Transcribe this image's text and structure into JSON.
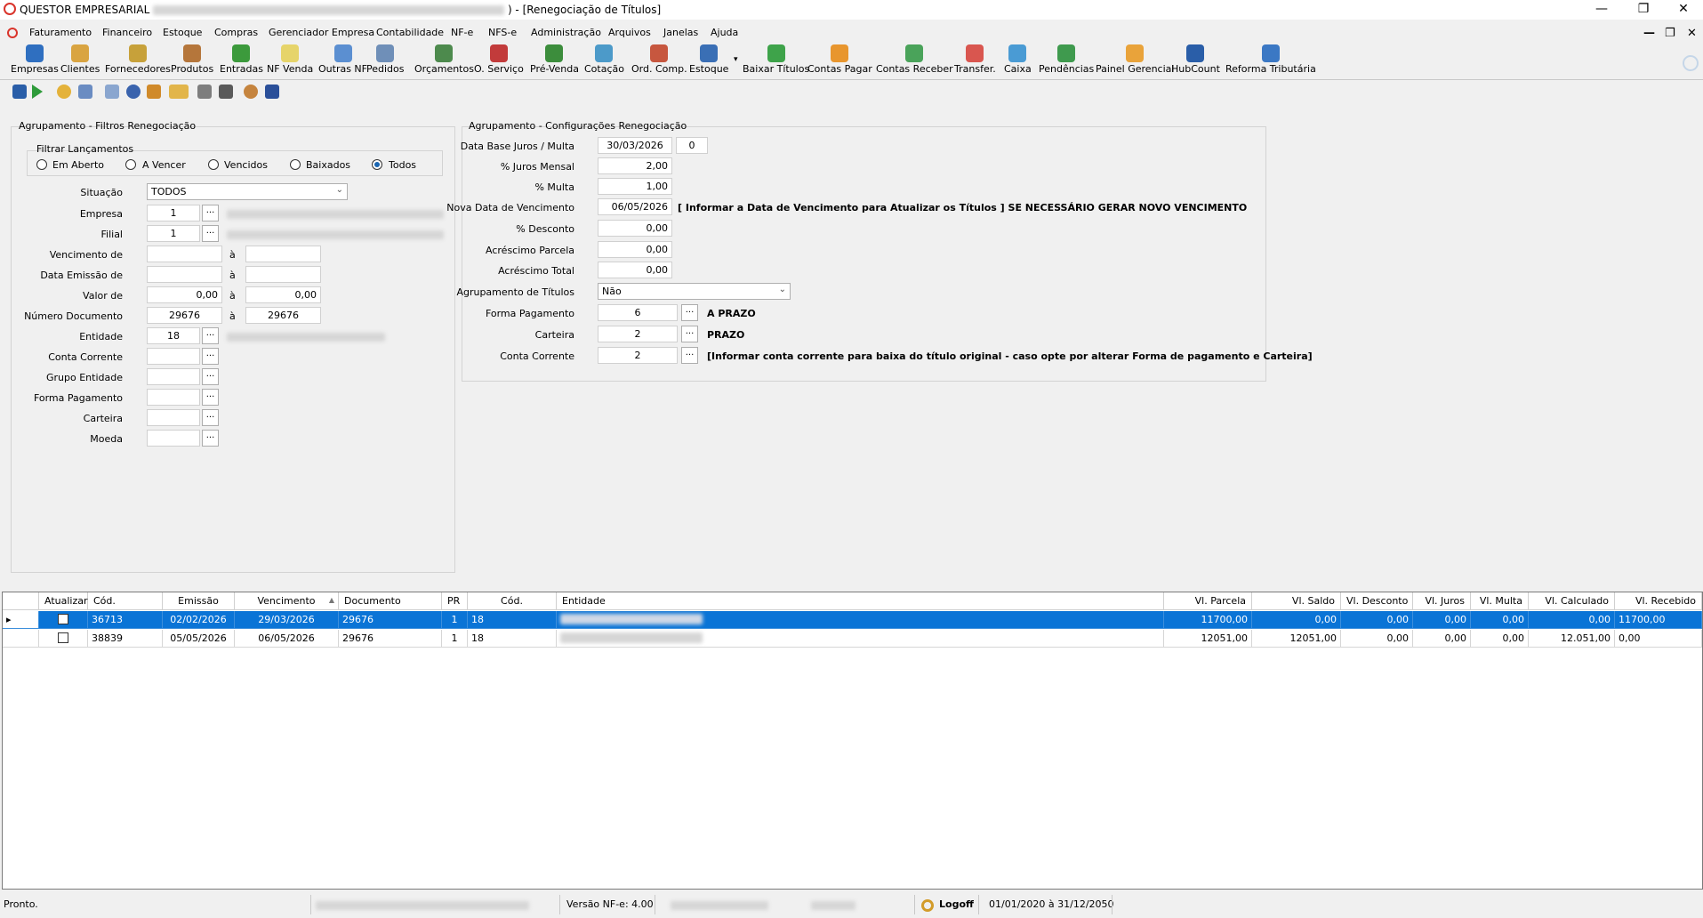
{
  "window": {
    "app_title": "QUESTOR EMPRESARIAL",
    "doc_title": ") - [Renegociação de Títulos]"
  },
  "menu": [
    "Faturamento",
    "Financeiro",
    "Estoque",
    "Compras",
    "Gerenciador Empresa",
    "Contabilidade",
    "NF-e",
    "NFS-e",
    "Administração",
    "Arquivos",
    "Janelas",
    "Ajuda"
  ],
  "toolbar": [
    {
      "label": "Empresas",
      "icon": "empresas-icon",
      "color": "#2f6fc0"
    },
    {
      "label": "Clientes",
      "icon": "clientes-icon",
      "color": "#d9a441"
    },
    {
      "label": "Fornecedores",
      "icon": "fornecedores-icon",
      "color": "#c7a13a"
    },
    {
      "label": "Produtos",
      "icon": "produtos-icon",
      "color": "#b5763b"
    },
    {
      "label": "Entradas",
      "icon": "entradas-icon",
      "color": "#3c9a3c"
    },
    {
      "label": "NF Venda",
      "icon": "nf-venda-icon",
      "color": "#e6d46a"
    },
    {
      "label": "Outras NF",
      "icon": "outras-nf-icon",
      "color": "#5b8fd1"
    },
    {
      "label": "Pedidos",
      "icon": "pedidos-icon",
      "color": "#6f8fb8"
    },
    {
      "label": "Orçamentos",
      "icon": "orcamentos-icon",
      "color": "#4d8a4d"
    },
    {
      "label": "O. Serviço",
      "icon": "ordem-servico-icon",
      "color": "#c23b3b"
    },
    {
      "label": "Pré-Venda",
      "icon": "pre-venda-icon",
      "color": "#3c8d3c"
    },
    {
      "label": "Cotação",
      "icon": "cotacao-icon",
      "color": "#4c9ac9"
    },
    {
      "label": "Ord. Comp.",
      "icon": "ordem-compra-icon",
      "color": "#c7573f"
    },
    {
      "label": "Estoque",
      "icon": "estoque-icon",
      "color": "#3a6fb5"
    },
    {
      "label": "Baixar Títulos",
      "icon": "baixar-titulos-icon",
      "color": "#3ea34a"
    },
    {
      "label": "Contas Pagar",
      "icon": "contas-pagar-icon",
      "color": "#e8962e"
    },
    {
      "label": "Contas Receber",
      "icon": "contas-receber-icon",
      "color": "#4aa35a"
    },
    {
      "label": "Transfer.",
      "icon": "transferencia-icon",
      "color": "#d9564f"
    },
    {
      "label": "Caixa",
      "icon": "caixa-icon",
      "color": "#4a9bd4"
    },
    {
      "label": "Pendências",
      "icon": "pendencias-icon",
      "color": "#3f9a4e"
    },
    {
      "label": "Painel Gerencial",
      "icon": "painel-gerencial-icon",
      "color": "#e9a33a"
    },
    {
      "label": "HubCount",
      "icon": "hubcount-icon",
      "color": "#2a5ea8"
    },
    {
      "label": "Reforma Tributária",
      "icon": "reforma-tributaria-icon",
      "color": "#3b78c4"
    }
  ],
  "filters": {
    "group_title": "Agrupamento - Filtros Renegociação",
    "launch_title": "Filtrar Lançamentos",
    "radios": [
      "Em Aberto",
      "A Vencer",
      "Vencidos",
      "Baixados",
      "Todos"
    ],
    "radio_selected": "Todos",
    "labels": {
      "situacao": "Situação",
      "empresa": "Empresa",
      "filial": "Filial",
      "vencimento": "Vencimento de",
      "emissao": "Data Emissão de",
      "valor": "Valor de",
      "numero_doc": "Número Documento",
      "entidade": "Entidade",
      "conta_corrente": "Conta Corrente",
      "grupo_entidade": "Grupo Entidade",
      "forma_pagamento": "Forma Pagamento",
      "carteira": "Carteira",
      "moeda": "Moeda"
    },
    "to_sep": "à",
    "situacao_value": "TODOS",
    "empresa_value": "1",
    "filial_value": "1",
    "valor_from": "0,00",
    "valor_to": "0,00",
    "numero_doc_from": "29676",
    "numero_doc_to": "29676",
    "entidade_value": "18",
    "dots": "..."
  },
  "config": {
    "group_title": "Agrupamento - Configurações Renegociação",
    "labels": {
      "data_base": "Data Base Juros / Multa",
      "juros": "% Juros Mensal",
      "multa": "% Multa",
      "nova_data": "Nova Data de Vencimento",
      "desconto": "% Desconto",
      "acrescimo_parcela": "Acréscimo Parcela",
      "acrescimo_total": "Acréscimo Total",
      "agrupamento": "Agrupamento de Títulos",
      "forma_pagamento": "Forma Pagamento",
      "carteira": "Carteira",
      "conta_corrente": "Conta Corrente"
    },
    "data_base_value": "30/03/2026",
    "data_base_days": "0",
    "juros_value": "2,00",
    "multa_value": "1,00",
    "nova_data_value": "06/05/2026",
    "nova_data_hint": "[ Informar a Data de Vencimento para Atualizar os Títulos ] SE NECESSÁRIO GERAR NOVO VENCIMENTO",
    "desconto_value": "0,00",
    "acrescimo_parcela_value": "0,00",
    "acrescimo_total_value": "0,00",
    "agrupamento_value": "Não",
    "forma_pagamento_value": "6",
    "forma_pagamento_desc": "A PRAZO",
    "carteira_value": "2",
    "carteira_desc": "PRAZO",
    "conta_corrente_value": "2",
    "conta_corrente_hint": "[Informar conta corrente para baixa do título original - caso opte por alterar Forma de pagamento e Carteira]"
  },
  "grid": {
    "columns": [
      "Atualizar",
      "Cód.",
      "Emissão",
      "Vencimento",
      "Documento",
      "PR",
      "Cód.",
      "Entidade",
      "Vl. Parcela",
      "Vl. Saldo",
      "Vl. Desconto",
      "Vl. Juros",
      "Vl. Multa",
      "Vl. Calculado",
      "Vl. Recebido"
    ],
    "rows": [
      {
        "cod": "36713",
        "emissao": "02/02/2026",
        "vencimento": "29/03/2026",
        "documento": "29676",
        "pr": "1",
        "cod_ent": "18",
        "parcela": "11700,00",
        "saldo": "0,00",
        "desconto": "0,00",
        "juros": "0,00",
        "multa": "0,00",
        "calculado": "0,00",
        "recebido": "11700,00"
      },
      {
        "cod": "38839",
        "emissao": "05/05/2026",
        "vencimento": "06/05/2026",
        "documento": "29676",
        "pr": "1",
        "cod_ent": "18",
        "parcela": "12051,00",
        "saldo": "12051,00",
        "desconto": "0,00",
        "juros": "0,00",
        "multa": "0,00",
        "calculado": "12.051,00",
        "recebido": "0,00"
      }
    ],
    "selection_color": "#0a74d6"
  },
  "status": {
    "ready": "Pronto.",
    "nfe_version": "Versão NF-e: 4.00",
    "logoff": "Logoff",
    "period": "01/01/2020 à 31/12/2050"
  }
}
